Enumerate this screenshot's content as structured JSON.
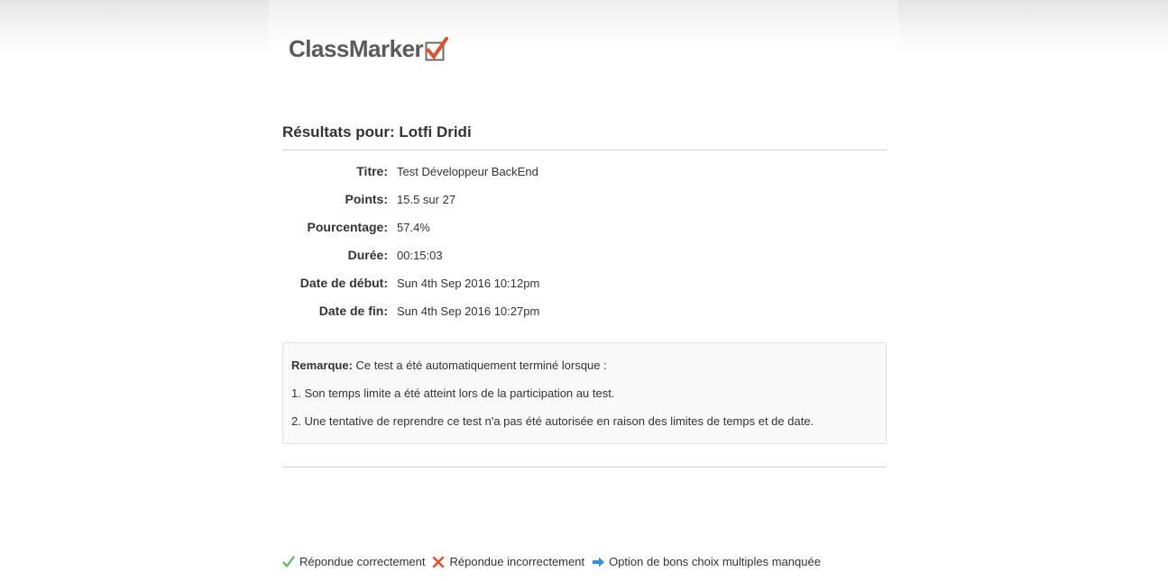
{
  "brand": {
    "name": "ClassMarker"
  },
  "results": {
    "heading": "Résultats pour: Lotfi Dridi",
    "rows": [
      {
        "label": "Titre:",
        "value": "Test Développeur BackEnd"
      },
      {
        "label": "Points:",
        "value": "15.5 sur 27"
      },
      {
        "label": "Pourcentage:",
        "value": "57.4%"
      },
      {
        "label": "Durée:",
        "value": "00:15:03"
      },
      {
        "label": "Date de début:",
        "value": "Sun 4th Sep 2016 10:12pm"
      },
      {
        "label": "Date de fin:",
        "value": "Sun 4th Sep 2016 10:27pm"
      }
    ]
  },
  "note": {
    "label": "Remarque:",
    "intro": " Ce test a été automatiquement terminé lorsque :",
    "items": [
      "1. Son temps limite a été atteint lors de la participation au test.",
      "2. Une tentative de reprendre ce test n'a pas été autorisée en raison des limites de temps et de date."
    ]
  },
  "legend": [
    {
      "icon": "checkmark-icon",
      "color": "#5cb85c",
      "label": "Répondue correctement"
    },
    {
      "icon": "cross-icon",
      "color": "#e0502f",
      "label": "Répondue incorrectement"
    },
    {
      "icon": "arrow-right-icon",
      "color": "#3b8fe0",
      "label": "Option de bons choix multiples manquée"
    }
  ],
  "colors": {
    "logo_check": "#e0502f",
    "text": "#333333",
    "rule": "#d6d6d6"
  }
}
